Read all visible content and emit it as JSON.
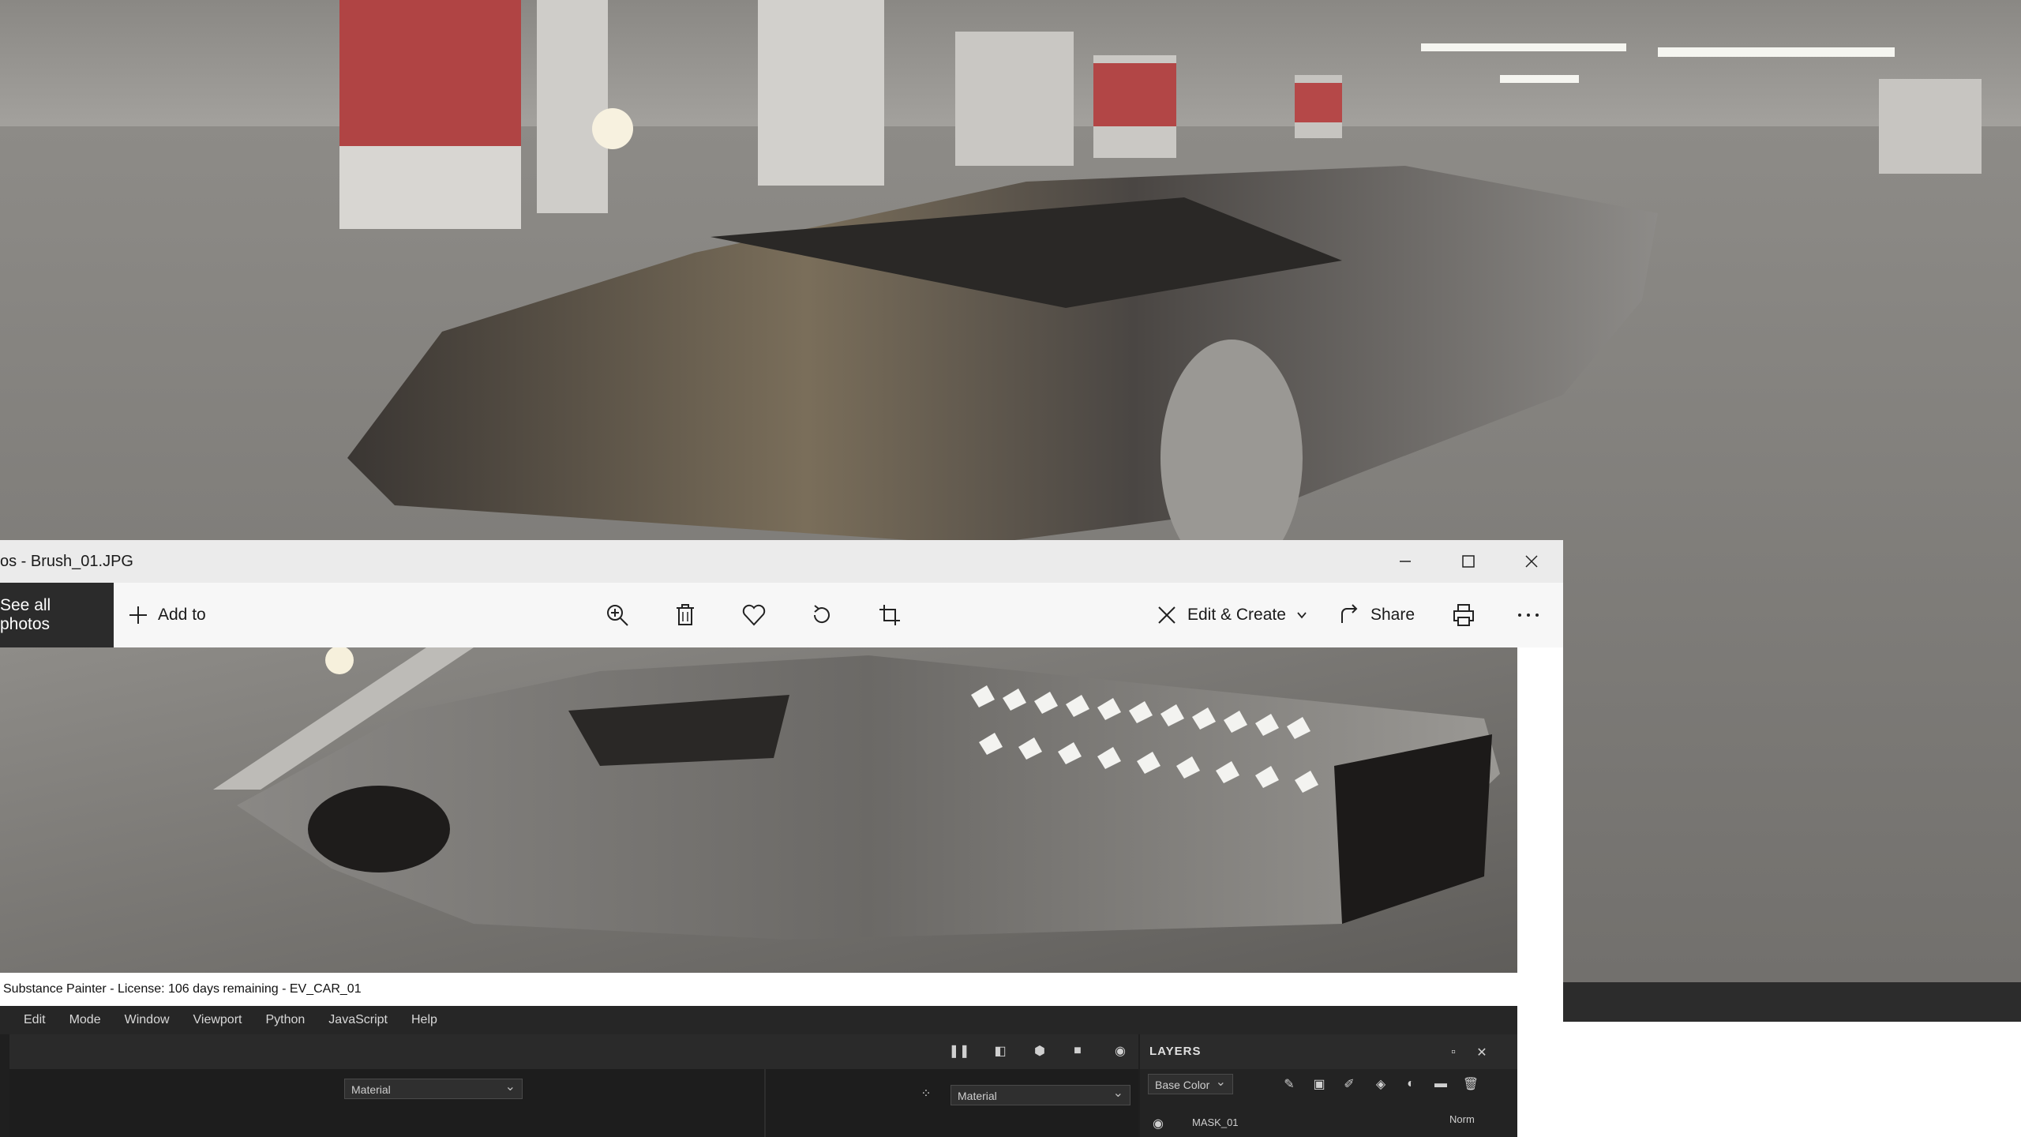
{
  "photos_window": {
    "title": "os - Brush_01.JPG",
    "caption_controls": {
      "minimize_icon": "minimize-icon",
      "maximize_icon": "maximize-icon",
      "close_icon": "close-icon"
    },
    "toolbar": {
      "see_all": "See all photos",
      "add_to": "Add to",
      "edit_create": "Edit & Create",
      "share": "Share",
      "icons": [
        "zoom-in-icon",
        "delete-icon",
        "favorite-icon",
        "rotate-icon",
        "crop-icon",
        "print-icon",
        "more-icon"
      ]
    }
  },
  "substance_painter": {
    "title": "Substance Painter - License: 106 days remaining - EV_CAR_01",
    "menu": [
      "Edit",
      "Mode",
      "Window",
      "Viewport",
      "Python",
      "JavaScript",
      "Help"
    ],
    "material_select_left": "Material",
    "material_select_right": "Material",
    "layers_panel": {
      "header": "LAYERS",
      "channel_select": "Base Color",
      "first_layer": "MASK_01",
      "blend_mode": "Norm"
    }
  },
  "colors": {
    "dark_panel": "#1f1f1f",
    "toolbar_dark": "#2b2b2b",
    "photos_toolbar": "#f7f7f7"
  }
}
